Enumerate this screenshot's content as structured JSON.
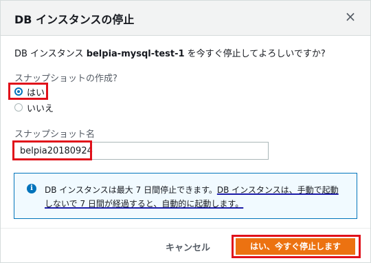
{
  "dialog": {
    "title": "DB インスタンスの停止",
    "close_glyph": "×"
  },
  "question": {
    "prefix": "DB インスタンス ",
    "instance": "belpia-mysql-test-1",
    "suffix": " を今すぐ停止してよろしいですか?"
  },
  "snapshot": {
    "label": "スナップショットの作成?",
    "options": [
      {
        "label": "はい",
        "checked": true
      },
      {
        "label": "いいえ",
        "checked": false
      }
    ]
  },
  "snapshot_name": {
    "label": "スナップショット名",
    "value": "belpia20180924"
  },
  "info": {
    "icon": "info-icon",
    "text_plain": "DB インスタンスは最大 7 日間停止できます。",
    "text_underlined": "DB インスタンスは、手動で起動しないで 7 日間が経過すると、自動的に起動します。"
  },
  "buttons": {
    "cancel": "キャンセル",
    "confirm": "はい、今すぐ停止します"
  },
  "colors": {
    "primary": "#ec7211",
    "accent": "#0073bb",
    "highlight": "#e0101a"
  }
}
